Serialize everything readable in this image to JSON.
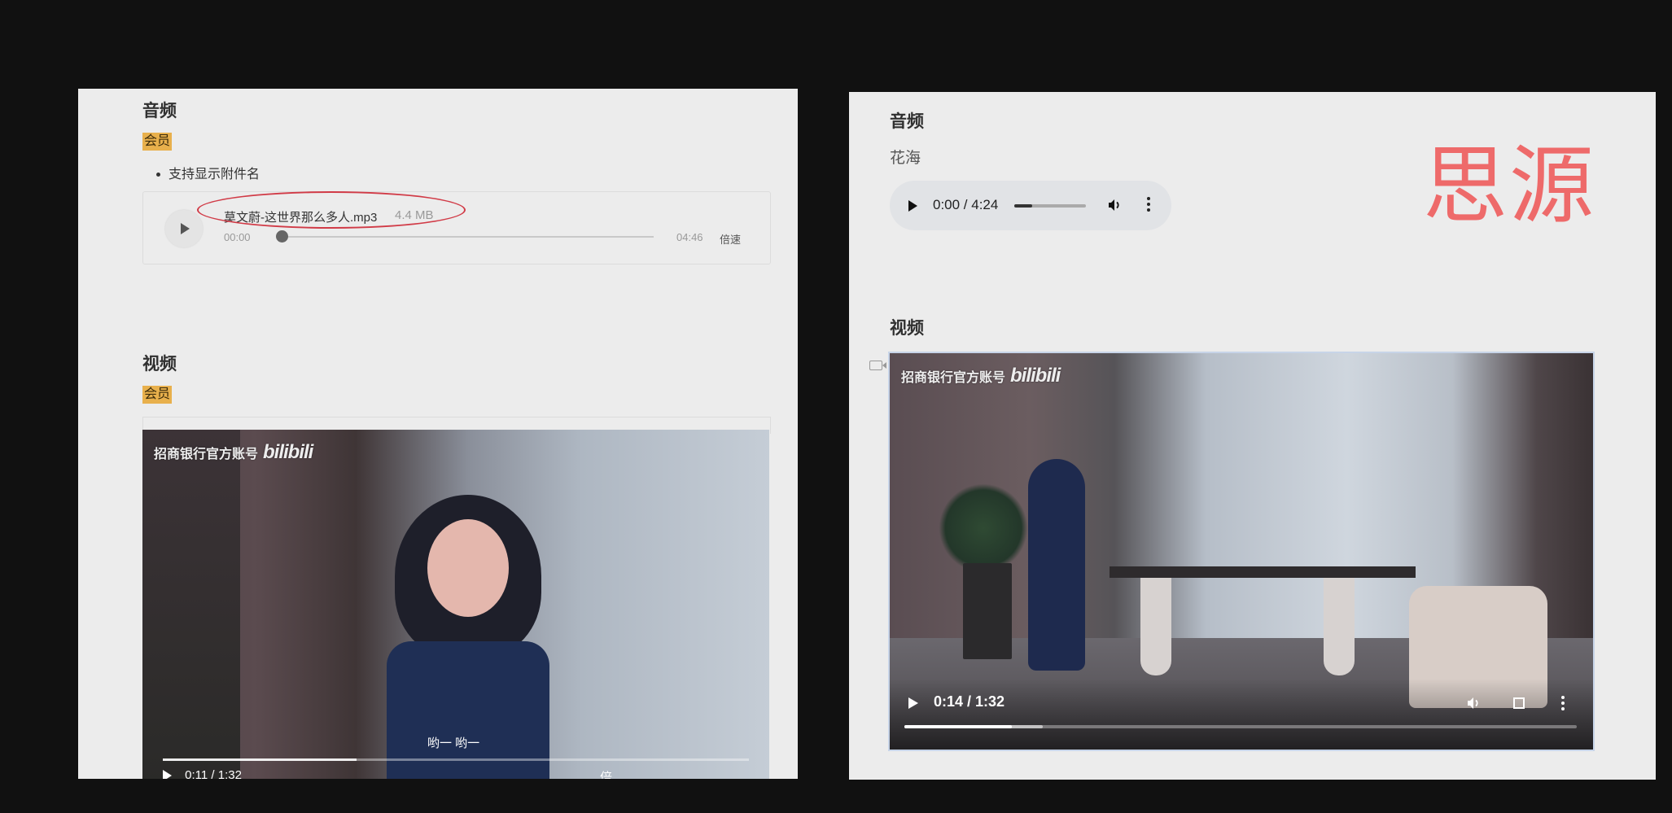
{
  "left": {
    "audio_heading": "音频",
    "member_badge": "会员",
    "bullet_text": "支持显示附件名",
    "audio": {
      "filename": "莫文蔚-这世界那么多人.mp3",
      "filesize": "4.4 MB",
      "time_start": "00:00",
      "time_end": "04:46",
      "speed_label": "倍速"
    },
    "video_heading": "视频",
    "video_badge": "会员",
    "video": {
      "watermark": "招商银行官方账号",
      "watermark_logo": "bilibili",
      "subtitle": "哟一 哟一",
      "time": "0:11 / 1:32",
      "speed_label": "倍速",
      "progress_fraction": 0.33
    }
  },
  "right": {
    "audio_heading": "音频",
    "song_title": "花海",
    "audio": {
      "time": "0:00 / 4:24",
      "progress_fraction": 0.25
    },
    "brand_text": "思源",
    "video_heading": "视频",
    "video": {
      "watermark": "招商银行官方账号",
      "watermark_logo": "bilibili",
      "time": "0:14 / 1:32",
      "progress_fraction": 0.16
    }
  },
  "colors": {
    "badge": "#e8b04c",
    "annotation_ellipse": "#d13b47",
    "brand_text": "#ee6a6a",
    "video_border": "#c7d4e8"
  },
  "icons": [
    "play-icon",
    "volume-icon",
    "more-vert-icon",
    "fullscreen-icon",
    "video-camera-icon"
  ]
}
